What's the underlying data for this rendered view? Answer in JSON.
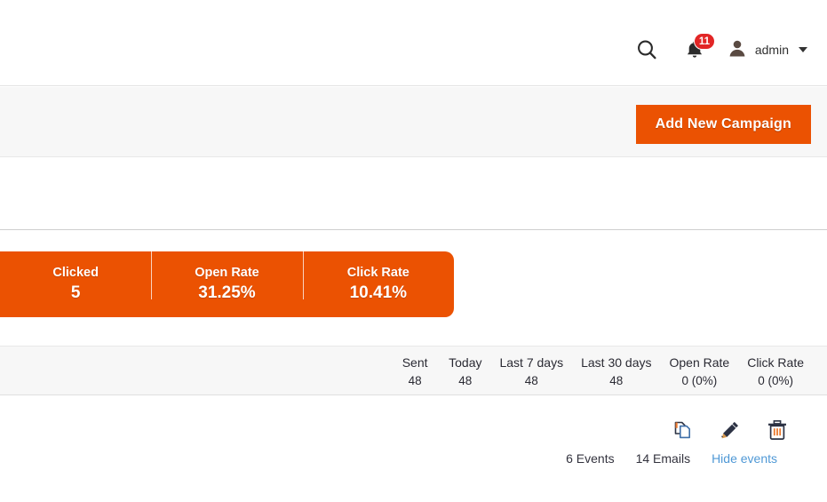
{
  "header": {
    "search_icon": "search-icon",
    "notifications": {
      "icon": "bell-icon",
      "count": "11"
    },
    "user": {
      "avatar_icon": "user-avatar-icon",
      "name": "admin",
      "caret_icon": "chevron-down-icon"
    }
  },
  "page_actions": {
    "add_campaign_label": "Add New Campaign"
  },
  "summary": {
    "accent_color": "#eb5202",
    "cells": [
      {
        "label": "Clicked",
        "value": "5"
      },
      {
        "label": "Open Rate",
        "value": "31.25%"
      },
      {
        "label": "Click Rate",
        "value": "10.41%"
      }
    ]
  },
  "stats": {
    "columns": [
      {
        "head": "Sent",
        "value": "48"
      },
      {
        "head": "Today",
        "value": "48"
      },
      {
        "head": "Last 7 days",
        "value": "48"
      },
      {
        "head": "Last 30 days",
        "value": "48"
      },
      {
        "head": "Open Rate",
        "value": "0 (0%)"
      },
      {
        "head": "Click Rate",
        "value": "0 (0%)"
      }
    ]
  },
  "row_actions": {
    "icons": [
      {
        "name": "duplicate-icon"
      },
      {
        "name": "edit-pencil-icon"
      },
      {
        "name": "delete-trash-icon"
      }
    ],
    "events_text": "6 Events",
    "emails_text": "14 Emails",
    "hide_events_link": "Hide events",
    "link_color": "#5099d6"
  }
}
